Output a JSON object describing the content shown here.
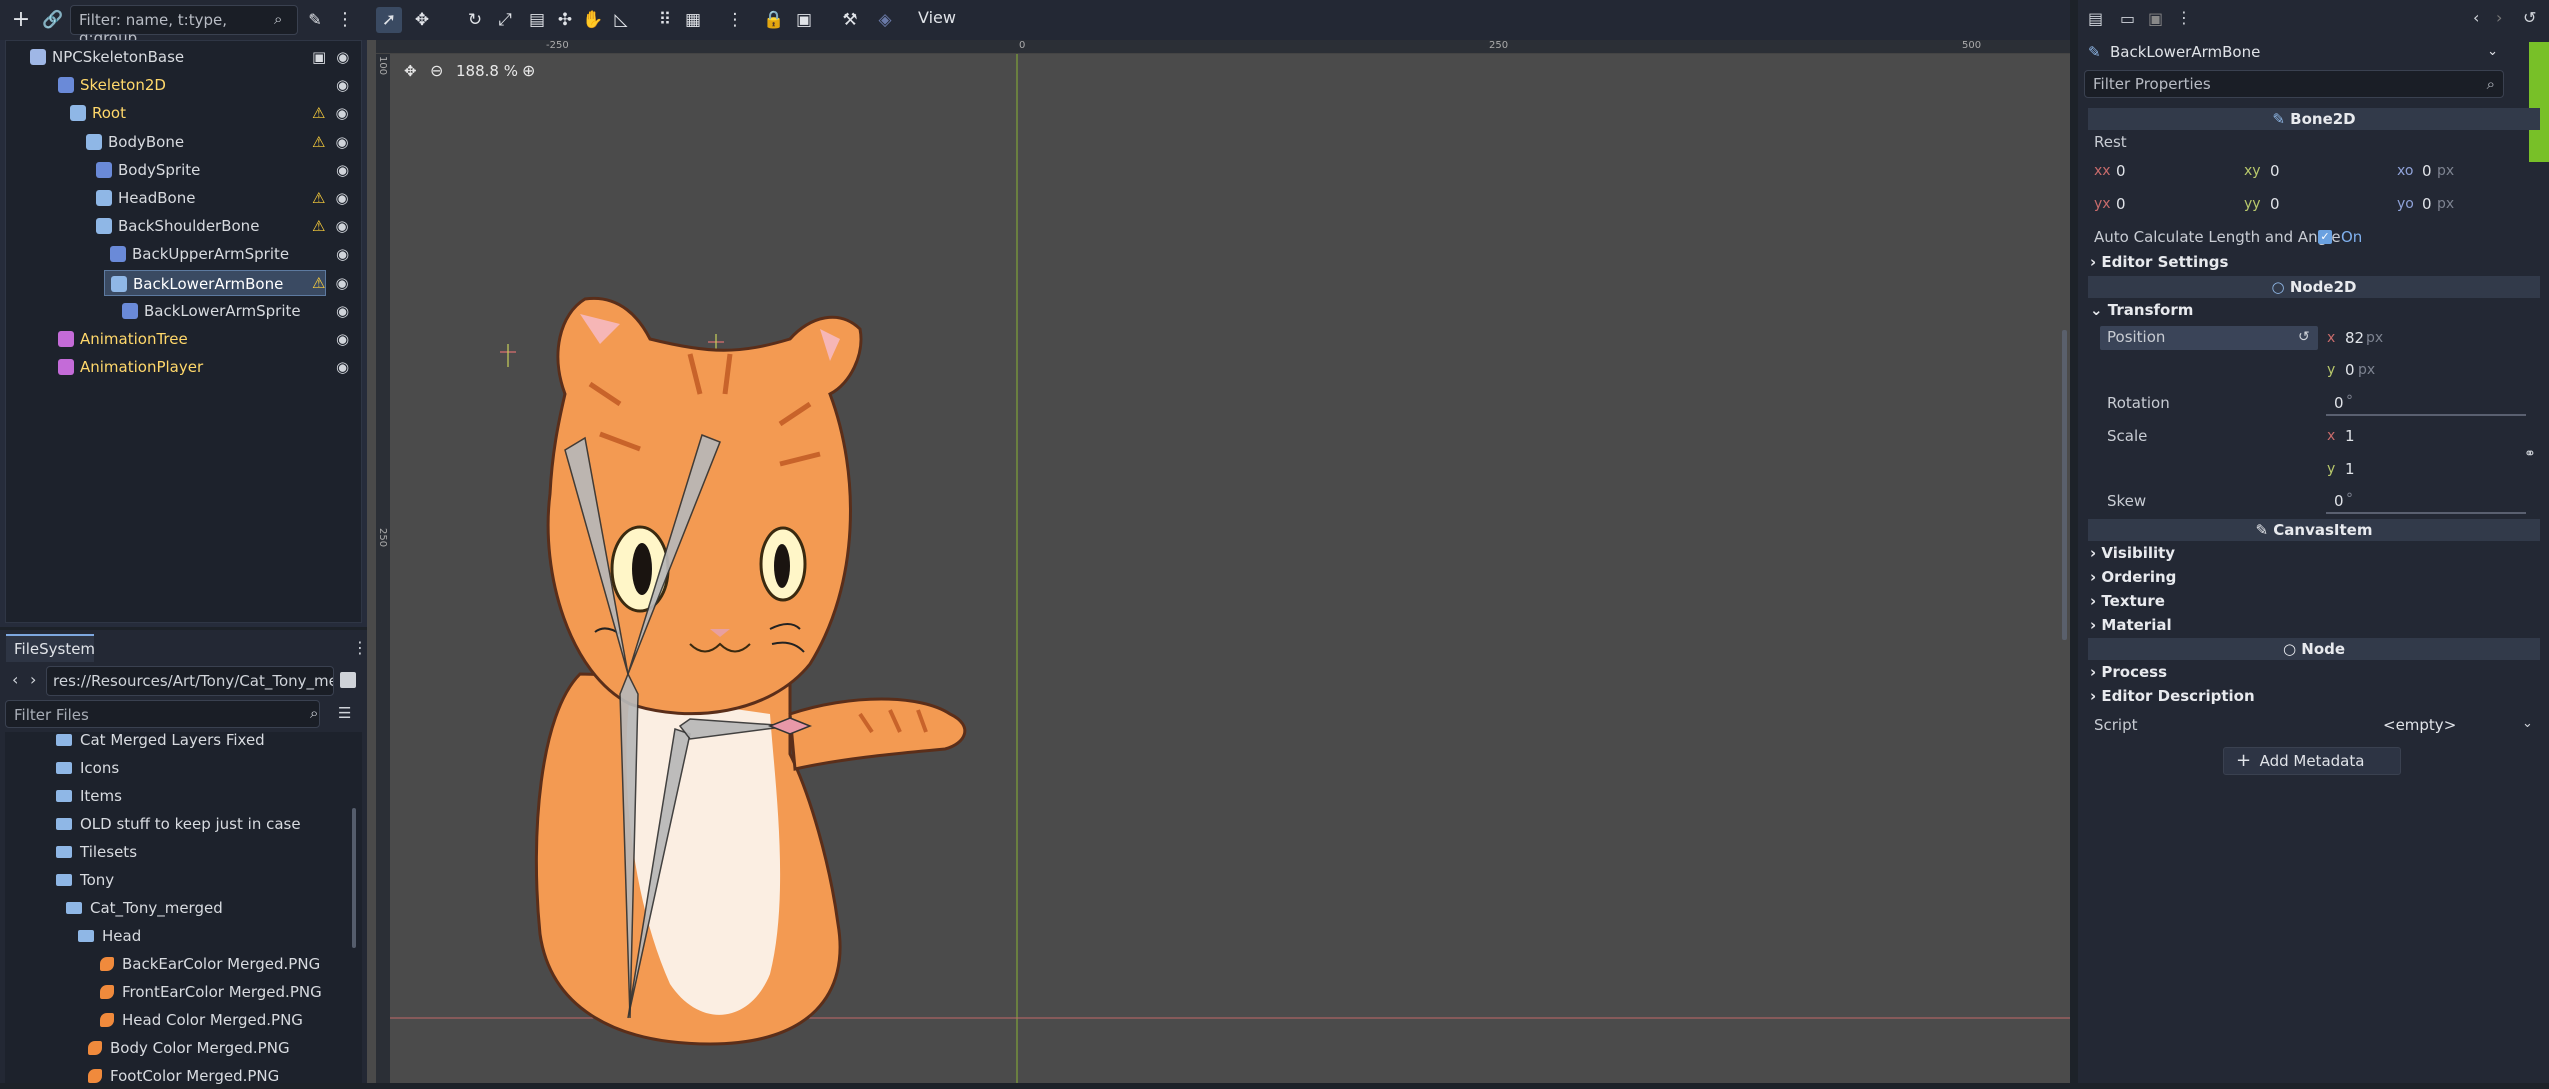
{
  "scene_dock": {
    "filter_placeholder": "Filter: name, t:type, g:group",
    "nodes": [
      {
        "label": "NPCSkeletonBase",
        "color": "#d8dbe0",
        "warning": false
      },
      {
        "label": "Skeleton2D",
        "color": "#ffd86b",
        "warning": false
      },
      {
        "label": "Root",
        "color": "#ffd86b",
        "warning": true
      },
      {
        "label": "BodyBone",
        "color": "#d8dbe0",
        "warning": true
      },
      {
        "label": "BodySprite",
        "color": "#d8dbe0",
        "warning": false
      },
      {
        "label": "HeadBone",
        "color": "#d8dbe0",
        "warning": true
      },
      {
        "label": "BackShoulderBone",
        "color": "#d8dbe0",
        "warning": true
      },
      {
        "label": "BackUpperArmSprite",
        "color": "#d8dbe0",
        "warning": false
      },
      {
        "label": "BackLowerArmBone",
        "color": "#ffffff",
        "warning": true
      },
      {
        "label": "BackLowerArmSprite",
        "color": "#d8dbe0",
        "warning": false
      },
      {
        "label": "AnimationTree",
        "color": "#ffd86b",
        "warning": false
      },
      {
        "label": "AnimationPlayer",
        "color": "#ffd86b",
        "warning": false
      }
    ]
  },
  "filesystem": {
    "tab_label": "FileSystem",
    "path": "res://Resources/Art/Tony/Cat_Tony_merg",
    "filter_placeholder": "Filter Files",
    "items": [
      "Cat Merged Layers Fixed",
      "Icons",
      "Items",
      "OLD stuff to keep just in case",
      "Tilesets",
      "Tony",
      "Cat_Tony_merged",
      "Head",
      "BackEarColor Merged.PNG",
      "FrontEarColor Merged.PNG",
      "Head Color Merged.PNG",
      "Body Color Merged.PNG",
      "FootColor Merged.PNG"
    ]
  },
  "viewport": {
    "view_menu": "View",
    "zoom_label": "188.8 %",
    "ruler_top": [
      "-250",
      "0",
      "250",
      "500"
    ],
    "ruler_left": [
      "100",
      "250"
    ]
  },
  "inspector": {
    "node_name": "BackLowerArmBone",
    "filter_placeholder": "Filter Properties",
    "bone2d_header": "Bone2D",
    "rest_label": "Rest",
    "rest": {
      "xx": "0",
      "xy": "0",
      "xo": "0",
      "yx": "0",
      "yy": "0",
      "yo": "0"
    },
    "auto_calc_label": "Auto Calculate Length and Angle",
    "auto_calc_value": "On",
    "editor_settings": "Editor Settings",
    "node2d_header": "Node2D",
    "transform_label": "Transform",
    "position_label": "Position",
    "position": {
      "x": "82",
      "y": "0"
    },
    "rotation_label": "Rotation",
    "rotation": "0",
    "scale_label": "Scale",
    "scale": {
      "x": "1",
      "y": "1"
    },
    "skew_label": "Skew",
    "skew": "0",
    "px_unit": "px",
    "deg_unit": "°",
    "canvasitem_header": "CanvasItem",
    "canvas_sections": [
      "Visibility",
      "Ordering",
      "Texture",
      "Material"
    ],
    "node_header": "Node",
    "node_sections": [
      "Process",
      "Editor Description"
    ],
    "script_label": "Script",
    "script_value": "<empty>",
    "add_metadata": "Add Metadata"
  }
}
